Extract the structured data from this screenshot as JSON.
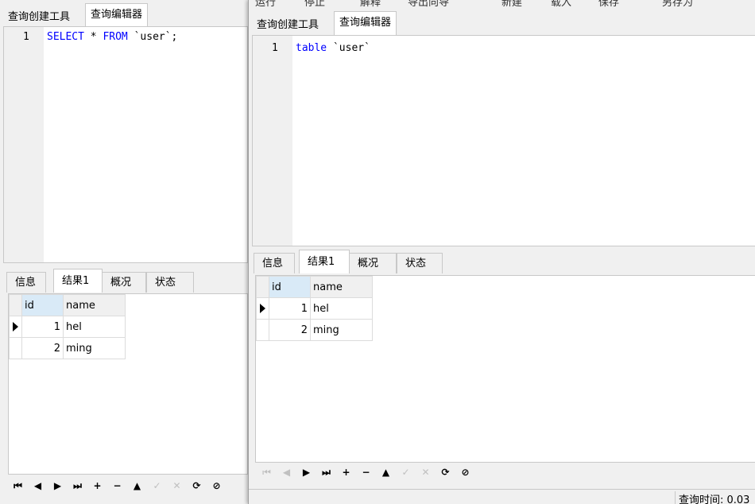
{
  "left_window": {
    "tabs": [
      "查询创建工具",
      "查询编辑器"
    ],
    "editor": {
      "line_number": "1",
      "sql": {
        "kw1": "SELECT",
        "mid": " * ",
        "kw2": "FROM",
        "rest": " `user`;"
      }
    },
    "result_tabs": [
      "信息",
      "结果1",
      "概况",
      "状态"
    ],
    "grid": {
      "columns": [
        "id",
        "name"
      ],
      "rows": [
        {
          "id": "1",
          "name": "hel"
        },
        {
          "id": "2",
          "name": "ming"
        }
      ]
    }
  },
  "right_window": {
    "toolbar": [
      "运行",
      "停止",
      "解释",
      "导出向导",
      "新建",
      "载入",
      "保存",
      "另存为"
    ],
    "tabs": [
      "查询创建工具",
      "查询编辑器"
    ],
    "editor": {
      "line_number": "1",
      "sql": {
        "kw1": "table",
        "rest": " `user`"
      }
    },
    "result_tabs": [
      "信息",
      "结果1",
      "概况",
      "状态"
    ],
    "grid": {
      "columns": [
        "id",
        "name"
      ],
      "rows": [
        {
          "id": "1",
          "name": "hel"
        },
        {
          "id": "2",
          "name": "ming"
        }
      ]
    },
    "status": {
      "query_time": "查询时间: 0.03"
    }
  },
  "nav_icons": [
    "first-record",
    "previous-record",
    "next-record",
    "last-record",
    "add-record",
    "delete-record",
    "move-up",
    "apply-changes",
    "discard-changes",
    "refresh",
    "stop"
  ],
  "nav_glyphs": [
    "⏮",
    "◀",
    "▶",
    "⏭",
    "+",
    "−",
    "▲",
    "✓",
    "✕",
    "⟳",
    "⊘"
  ],
  "colors": {
    "keyword": "#0000ff",
    "header_selected": "#d9eaf7"
  }
}
